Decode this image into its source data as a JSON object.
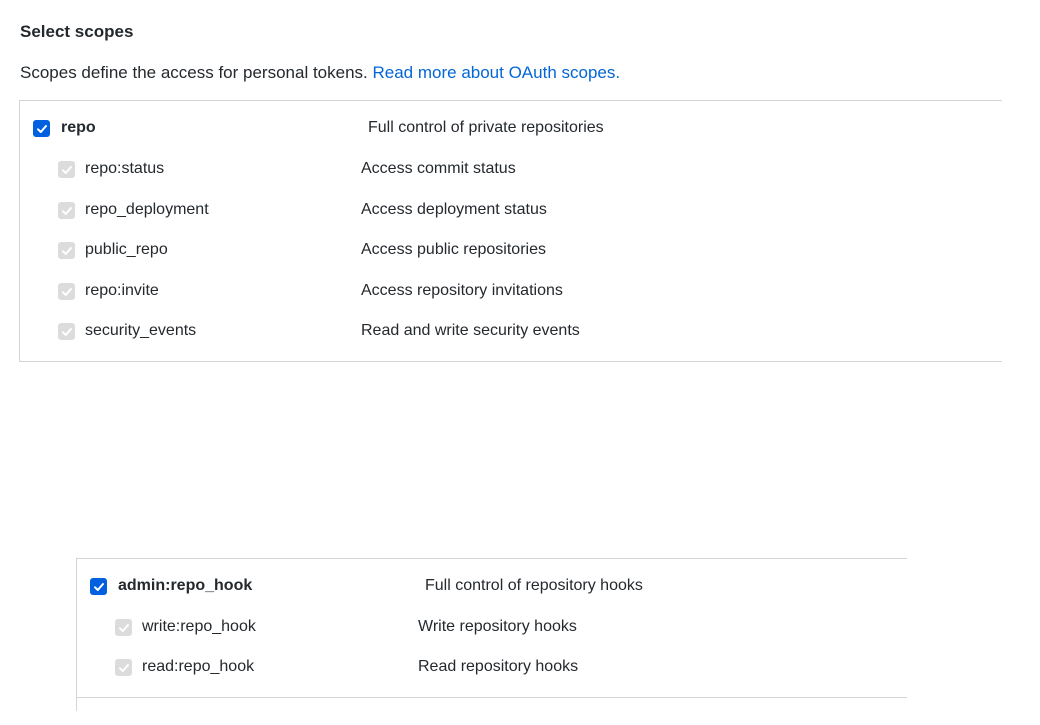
{
  "header": {
    "title": "Select scopes",
    "description": "Scopes define the access for personal tokens.",
    "link_text": "Read more about OAuth scopes."
  },
  "colors": {
    "accent": "#0060df",
    "link": "#0366d6",
    "border": "#d1d5da",
    "disabled_checkbox": "#dcdcdc"
  },
  "groups": [
    {
      "parent": {
        "name": "repo",
        "description": "Full control of private repositories",
        "checked": true
      },
      "children": [
        {
          "name": "repo:status",
          "description": "Access commit status",
          "checked": true,
          "disabled": true
        },
        {
          "name": "repo_deployment",
          "description": "Access deployment status",
          "checked": true,
          "disabled": true
        },
        {
          "name": "public_repo",
          "description": "Access public repositories",
          "checked": true,
          "disabled": true
        },
        {
          "name": "repo:invite",
          "description": "Access repository invitations",
          "checked": true,
          "disabled": true
        },
        {
          "name": "security_events",
          "description": "Read and write security events",
          "checked": true,
          "disabled": true
        }
      ]
    },
    {
      "parent": {
        "name": "admin:repo_hook",
        "description": "Full control of repository hooks",
        "checked": true
      },
      "children": [
        {
          "name": "write:repo_hook",
          "description": "Write repository hooks",
          "checked": true,
          "disabled": true
        },
        {
          "name": "read:repo_hook",
          "description": "Read repository hooks",
          "checked": true,
          "disabled": true
        }
      ]
    }
  ]
}
